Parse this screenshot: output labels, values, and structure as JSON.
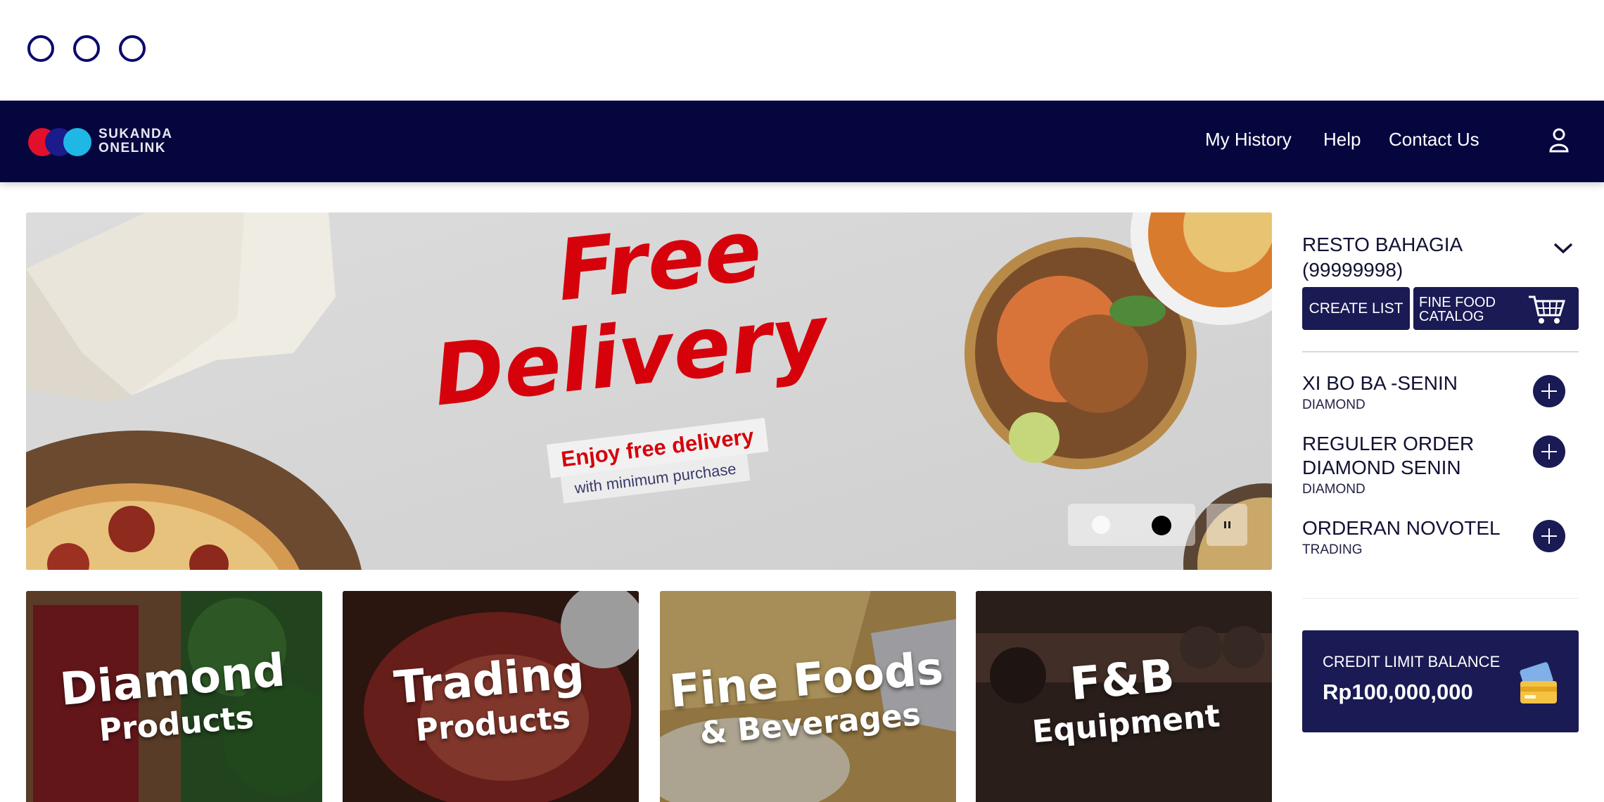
{
  "window": {
    "controls": [
      "circle",
      "circle",
      "circle"
    ]
  },
  "brand": {
    "line1": "SUKANDA",
    "line2": "ONELINK",
    "colors": [
      "#e3102c",
      "#1b1b8c",
      "#1fb8e6"
    ]
  },
  "nav": {
    "links": [
      "My History",
      "Help",
      "Contact Us"
    ],
    "user_icon": "user-icon"
  },
  "banner": {
    "title_line1": "Free",
    "title_line2": "Delivery",
    "tagline": "Enjoy free delivery",
    "subline": "with minimum purchase",
    "slide_count": 2,
    "active_slide": 2,
    "control_icon": "pause-icon"
  },
  "categories": [
    {
      "line1": "Diamond",
      "line2": "Products"
    },
    {
      "line1": "Trading",
      "line2": "Products"
    },
    {
      "line1": "Fine Foods",
      "line2": "& Beverages"
    },
    {
      "line1": "F&B",
      "line2": "Equipment"
    }
  ],
  "sidebar": {
    "store_name": "RESTO BAHAGIA (99999998)",
    "create_list_label": "CREATE LIST",
    "fine_food_label": "FINE FOOD CATALOG",
    "lists": [
      {
        "name": "XI BO BA -SENIN",
        "type": "DIAMOND"
      },
      {
        "name": "REGULER ORDER DIAMOND SENIN",
        "type": "DIAMOND"
      },
      {
        "name": "ORDERAN NOVOTEL",
        "type": "TRADING"
      }
    ],
    "credit": {
      "label": "CREDIT LIMIT BALANCE",
      "amount": "Rp100,000,000"
    }
  },
  "colors": {
    "navbar": "#06063f",
    "accent": "#1a1a55",
    "promo_red": "#d6020b"
  }
}
